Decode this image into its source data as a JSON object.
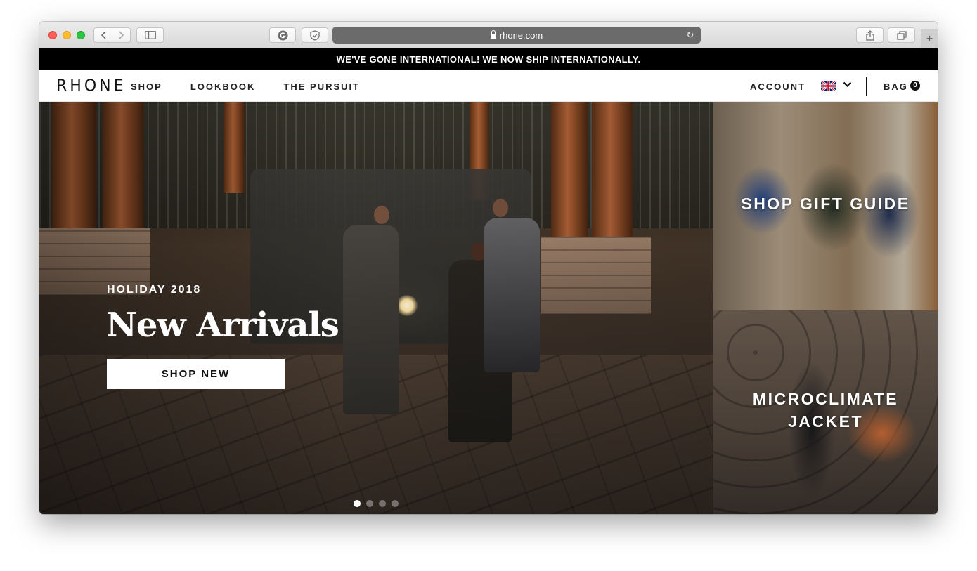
{
  "browser": {
    "url": "rhone.com"
  },
  "announcement": "WE'VE GONE INTERNATIONAL! WE NOW SHIP INTERNATIONALLY.",
  "header": {
    "logo": "RHONE",
    "nav": [
      "SHOP",
      "LOOKBOOK",
      "THE PURSUIT"
    ],
    "account": "ACCOUNT",
    "bag_label": "BAG",
    "bag_count": "0"
  },
  "hero": {
    "eyebrow": "HOLIDAY 2018",
    "title": "New Arrivals",
    "cta": "SHOP NEW",
    "slides_total": 4,
    "active_slide": 1
  },
  "tiles": [
    {
      "label": "SHOP GIFT GUIDE"
    },
    {
      "label": "MICROCLIMATE JACKET"
    }
  ],
  "colors": {
    "announcement_bg": "#000000",
    "text_on_image": "#ffffff"
  }
}
